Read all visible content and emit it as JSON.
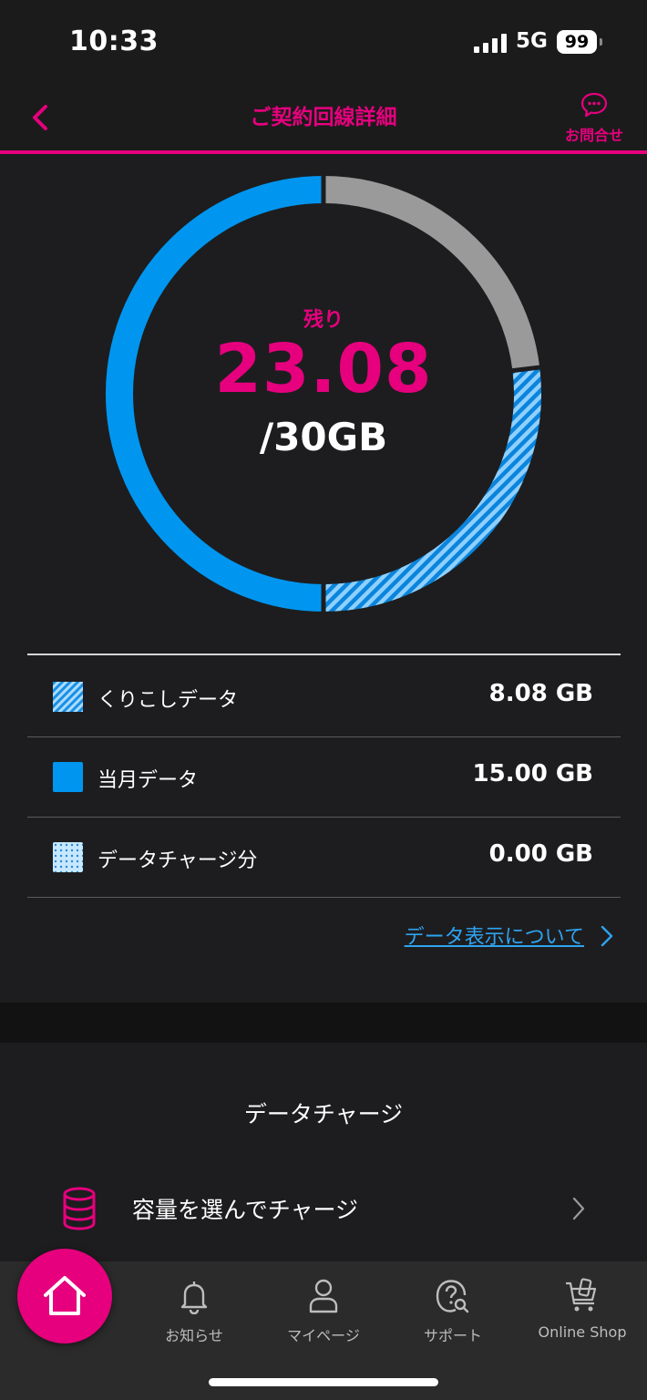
{
  "status_bar": {
    "time": "10:33",
    "network": "5G",
    "battery": "99"
  },
  "header": {
    "title": "ご契約回線詳細",
    "contact_label": "お問合せ"
  },
  "data_usage": {
    "remaining_label": "残り",
    "remaining_value": "23.08",
    "total": "/30GB",
    "segments": {
      "used_gb": 6.92,
      "carryover_gb": 8.08,
      "monthly_gb": 15.0,
      "charge_gb": 0.0,
      "total_gb": 30
    },
    "colors": {
      "used": "#9a9a9a",
      "monthly": "#0096f0",
      "carryover": "#2fa3f0",
      "accent": "#e6007e"
    }
  },
  "breakdown": [
    {
      "label": "くりこしデータ",
      "value": "8.08 GB",
      "swatch": "hatched"
    },
    {
      "label": "当月データ",
      "value": "15.00 GB",
      "swatch": "solid"
    },
    {
      "label": "データチャージ分",
      "value": "0.00 GB",
      "swatch": "dotted"
    }
  ],
  "about_link": "データ表示について",
  "charge": {
    "section_title": "データチャージ",
    "item_label": "容量を選んでチャージ"
  },
  "tabs": [
    {
      "label": "ホーム",
      "icon": "home-icon"
    },
    {
      "label": "お知らせ",
      "icon": "bell-icon"
    },
    {
      "label": "マイページ",
      "icon": "person-icon"
    },
    {
      "label": "サポート",
      "icon": "support-icon"
    },
    {
      "label": "Online Shop",
      "icon": "cart-icon"
    }
  ]
}
